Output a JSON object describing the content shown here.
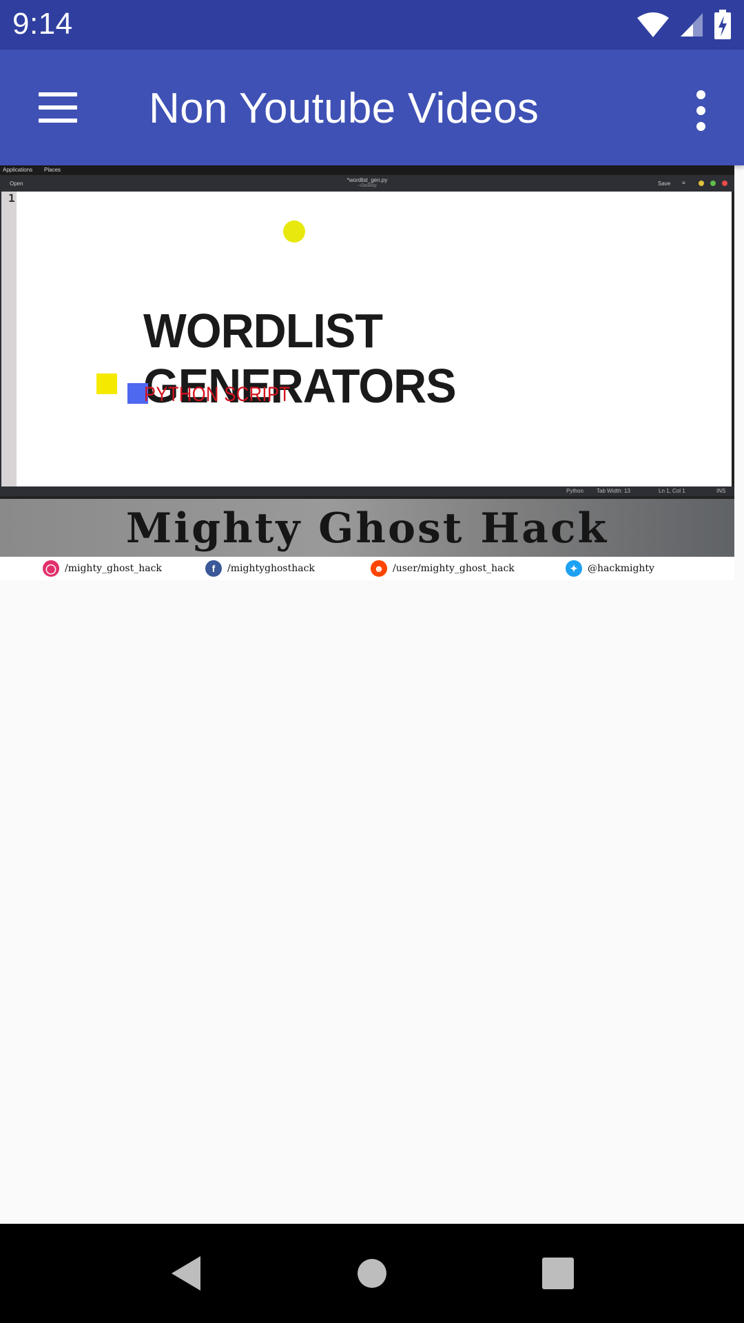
{
  "status_bar": {
    "time": "9:14",
    "icons": [
      "wifi-icon",
      "cell-signal-icon",
      "battery-charging-icon"
    ]
  },
  "app_bar": {
    "title": "Non Youtube Videos",
    "menu_icon": "hamburger-menu-icon",
    "overflow_icon": "more-vert-icon",
    "color": "#3f51b5",
    "status_color": "#303f9f"
  },
  "video": {
    "desktop_menu": [
      "Applications",
      "Places"
    ],
    "editor": {
      "open_label": "Open",
      "file_name": "*wordlist_gen.py",
      "file_path": "~/Desktop",
      "save_label": "Save",
      "line_number": "1",
      "status": [
        "Python",
        "Tab Width: 13",
        "Ln 1, Col 1",
        "INS"
      ]
    },
    "headline": "WORDLIST GENERATORS",
    "subhead": "PYTHON SCRIPT",
    "banner_title": "Mighty Ghost Hack",
    "social": [
      {
        "icon": "instagram-icon",
        "label": "/mighty_ghost_hack",
        "color": "#e1306c"
      },
      {
        "icon": "facebook-icon",
        "label": "/mightyghosthack",
        "color": "#3b5998"
      },
      {
        "icon": "reddit-icon",
        "label": "/user/mighty_ghost_hack",
        "color": "#ff4500"
      },
      {
        "icon": "twitter-icon",
        "label": "@hackmighty",
        "color": "#1da1f2"
      }
    ]
  },
  "nav_bar": {
    "buttons": [
      "back-icon",
      "home-icon",
      "recents-icon"
    ]
  }
}
